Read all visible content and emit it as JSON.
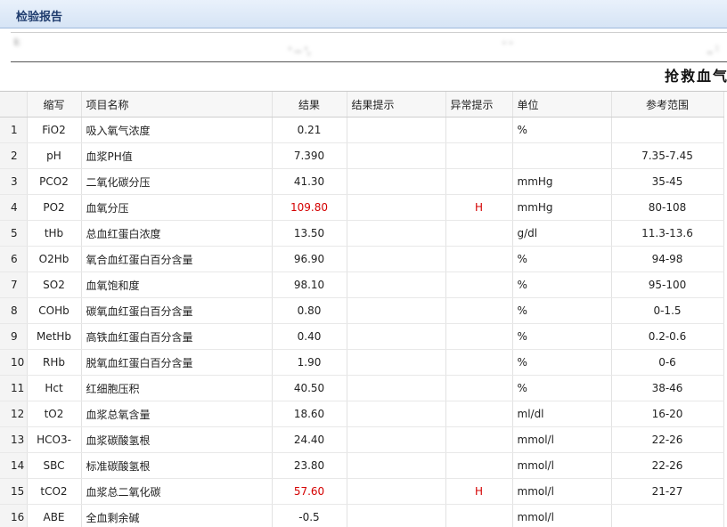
{
  "window": {
    "title": "检验报告"
  },
  "report_banner": "抢救血气",
  "patient_info_masked": {
    "left": "I:",
    "mid1": "' -- ',",
    "mid2": "- -",
    "right": "_ :"
  },
  "columns": [
    "",
    "缩写",
    "项目名称",
    "结果",
    "结果提示",
    "异常提示",
    "单位",
    "参考范围"
  ],
  "rows": [
    {
      "no": "1",
      "abbr": "FiO2",
      "name": "吸入氧气浓度",
      "result": "0.21",
      "hint": "",
      "flag": "",
      "unit": "%",
      "range": ""
    },
    {
      "no": "2",
      "abbr": "pH",
      "name": "血浆PH值",
      "result": "7.390",
      "hint": "",
      "flag": "",
      "unit": "",
      "range": "7.35-7.45"
    },
    {
      "no": "3",
      "abbr": "PCO2",
      "name": "二氧化碳分压",
      "result": "41.30",
      "hint": "",
      "flag": "",
      "unit": "mmHg",
      "range": "35-45"
    },
    {
      "no": "4",
      "abbr": "PO2",
      "name": "血氧分压",
      "result": "109.80",
      "hint": "",
      "flag": "H",
      "unit": "mmHg",
      "range": "80-108"
    },
    {
      "no": "5",
      "abbr": "tHb",
      "name": "总血红蛋白浓度",
      "result": "13.50",
      "hint": "",
      "flag": "",
      "unit": "g/dl",
      "range": "11.3-13.6"
    },
    {
      "no": "6",
      "abbr": "O2Hb",
      "name": "氧合血红蛋白百分含量",
      "result": "96.90",
      "hint": "",
      "flag": "",
      "unit": "%",
      "range": "94-98"
    },
    {
      "no": "7",
      "abbr": "SO2",
      "name": "血氧饱和度",
      "result": "98.10",
      "hint": "",
      "flag": "",
      "unit": "%",
      "range": "95-100"
    },
    {
      "no": "8",
      "abbr": "COHb",
      "name": "碳氧血红蛋白百分含量",
      "result": "0.80",
      "hint": "",
      "flag": "",
      "unit": "%",
      "range": "0-1.5"
    },
    {
      "no": "9",
      "abbr": "MetHb",
      "name": "高铁血红蛋白百分含量",
      "result": "0.40",
      "hint": "",
      "flag": "",
      "unit": "%",
      "range": "0.2-0.6"
    },
    {
      "no": "10",
      "abbr": "RHb",
      "name": "脱氧血红蛋白百分含量",
      "result": "1.90",
      "hint": "",
      "flag": "",
      "unit": "%",
      "range": "0-6"
    },
    {
      "no": "11",
      "abbr": "Hct",
      "name": "红细胞压积",
      "result": "40.50",
      "hint": "",
      "flag": "",
      "unit": "%",
      "range": "38-46"
    },
    {
      "no": "12",
      "abbr": "tO2",
      "name": "血浆总氧含量",
      "result": "18.60",
      "hint": "",
      "flag": "",
      "unit": "ml/dl",
      "range": "16-20"
    },
    {
      "no": "13",
      "abbr": "HCO3-",
      "name": "血浆碳酸氢根",
      "result": "24.40",
      "hint": "",
      "flag": "",
      "unit": "mmol/l",
      "range": "22-26"
    },
    {
      "no": "14",
      "abbr": "SBC",
      "name": "标准碳酸氢根",
      "result": "23.80",
      "hint": "",
      "flag": "",
      "unit": "mmol/l",
      "range": "22-26"
    },
    {
      "no": "15",
      "abbr": "tCO2",
      "name": "血浆总二氧化碳",
      "result": "57.60",
      "hint": "",
      "flag": "H",
      "unit": "mmol/l",
      "range": "21-27"
    },
    {
      "no": "16",
      "abbr": "ABE",
      "name": "全血剩余碱",
      "result": "-0.5",
      "hint": "",
      "flag": "",
      "unit": "mmol/l",
      "range": ""
    }
  ],
  "colors": {
    "abnormal": "#d40000",
    "title": "#1f3c6e"
  }
}
